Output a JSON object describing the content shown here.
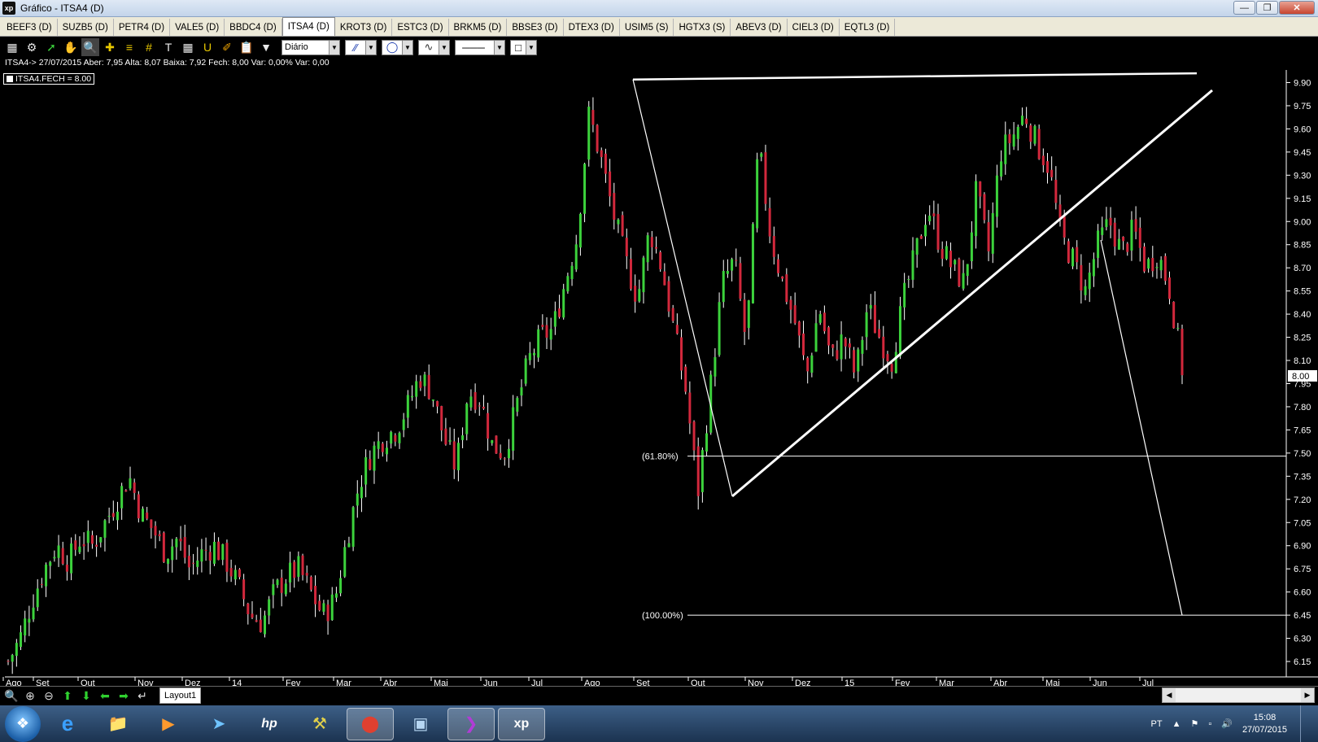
{
  "window": {
    "title": "Gráfico - ITSA4 (D)",
    "app_icon_text": "xp"
  },
  "tabs": [
    {
      "label": "BEEF3 (D)"
    },
    {
      "label": "SUZB5 (D)"
    },
    {
      "label": "PETR4 (D)"
    },
    {
      "label": "VALE5 (D)"
    },
    {
      "label": "BBDC4 (D)"
    },
    {
      "label": "ITSA4 (D)",
      "active": true
    },
    {
      "label": "KROT3 (D)"
    },
    {
      "label": "ESTC3 (D)"
    },
    {
      "label": "BRKM5 (D)"
    },
    {
      "label": "BBSE3 (D)"
    },
    {
      "label": "DTEX3 (D)"
    },
    {
      "label": "USIM5 (S)"
    },
    {
      "label": "HGTX3 (S)"
    },
    {
      "label": "ABEV3 (D)"
    },
    {
      "label": "CIEL3 (D)"
    },
    {
      "label": "EQTL3 (D)"
    }
  ],
  "toolbar": {
    "period": "Diário"
  },
  "info": {
    "summary": "ITSA4-> 27/07/2015 Aber: 7,95 Alta: 8,07 Baixa: 7,92 Fech: 8,00 Var: 0,00% Var: 0,00",
    "legend": "ITSA4.FECH = 8.00"
  },
  "chart_data": {
    "type": "candlestick",
    "symbol": "ITSA4",
    "ylim": [
      6.05,
      9.95
    ],
    "y_ticks": [
      "9.90",
      "9.75",
      "9.60",
      "9.45",
      "9.30",
      "9.15",
      "9.00",
      "8.85",
      "8.70",
      "8.55",
      "8.40",
      "8.25",
      "8.10",
      "7.95",
      "7.80",
      "7.65",
      "7.50",
      "7.35",
      "7.20",
      "7.05",
      "6.90",
      "6.75",
      "6.60",
      "6.45",
      "6.30",
      "6.15"
    ],
    "last_price_label": "8.00",
    "x_labels": [
      "Ago",
      "Set",
      "Out",
      "Nov",
      "Dez",
      "14",
      "Fev",
      "Mar",
      "Abr",
      "Mai",
      "Jun",
      "Jul",
      "Ago",
      "Set",
      "Out",
      "Nov",
      "Dez",
      "15",
      "Fev",
      "Mar",
      "Abr",
      "Mai",
      "Jun",
      "Jul"
    ],
    "colors": {
      "up": "#3cd23c",
      "down": "#d2283c",
      "wick": "#ffffff",
      "drawing": "#ffffff"
    },
    "series_close_path": [
      6.15,
      6.3,
      6.55,
      6.75,
      6.9,
      6.8,
      6.95,
      6.9,
      7.05,
      7.2,
      7.35,
      7.1,
      7.0,
      6.85,
      6.95,
      6.75,
      6.85,
      6.9,
      6.8,
      6.65,
      6.45,
      6.4,
      6.6,
      6.7,
      6.75,
      6.6,
      6.45,
      6.55,
      6.95,
      7.3,
      7.5,
      7.6,
      7.65,
      7.8,
      8.0,
      7.9,
      7.6,
      7.4,
      7.9,
      7.85,
      7.55,
      7.5,
      7.8,
      8.1,
      8.25,
      8.3,
      8.6,
      8.9,
      9.7,
      9.4,
      9.05,
      8.75,
      8.5,
      8.95,
      8.7,
      8.3,
      7.9,
      7.25,
      7.9,
      8.6,
      8.75,
      8.2,
      9.5,
      8.9,
      8.6,
      8.35,
      8.0,
      8.45,
      8.1,
      8.25,
      8.0,
      8.45,
      8.25,
      8.1,
      8.5,
      8.8,
      9.1,
      8.85,
      8.7,
      8.6,
      9.2,
      8.8,
      9.45,
      9.55,
      9.7,
      9.5,
      9.35,
      8.9,
      8.75,
      8.55,
      8.85,
      9.0,
      8.8,
      8.95,
      8.7,
      8.8,
      8.55,
      8.05
    ],
    "fib_levels": [
      {
        "label": "(61.80%)",
        "value": 7.48
      },
      {
        "label": "(100.00%)",
        "value": 6.45
      }
    ]
  },
  "bottom": {
    "layout_tab": "Layout1"
  },
  "taskbar": {
    "apps": [
      "ie-icon",
      "explorer-icon",
      "media-icon",
      "network-icon",
      "hp-icon",
      "tool-icon",
      "chrome-icon",
      "screen-icon",
      "arrow-app-icon",
      "xp-icon"
    ],
    "tray_lang": "PT",
    "time": "15:08",
    "date": "27/07/2015"
  }
}
